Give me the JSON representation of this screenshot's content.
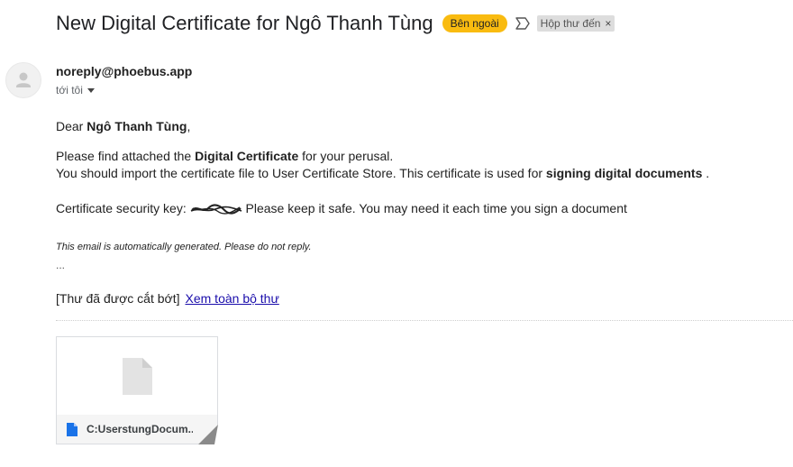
{
  "header": {
    "subject": "New Digital Certificate for Ngô Thanh Tùng",
    "external_badge": "Bên ngoài",
    "label": "Hộp thư đến",
    "label_remove": "×"
  },
  "sender": {
    "email": "noreply@phoebus.app",
    "recipient": "tới tôi"
  },
  "body": {
    "greeting_prefix": "Dear ",
    "greeting_name": "Ngô Thanh Tùng",
    "greeting_suffix": ",",
    "line1_prefix": "Please find attached the ",
    "line1_bold": "Digital Certificate",
    "line1_suffix": " for your perusal.",
    "line2_prefix": "You should import the certificate file to User Certificate Store. This certificate is used for ",
    "line2_bold": "signing digital documents",
    "line2_suffix": " .",
    "key_prefix": "Certificate security key: ",
    "key_suffix": " Please keep it safe. You may need it each time you sign a document",
    "auto_note": "This email is automatically generated. Please do not reply.",
    "ellipsis": "...",
    "clipped_text": "[Thư đã được cắt bớt]",
    "view_full_link": "Xem toàn bộ thư"
  },
  "attachment": {
    "file_name": "C:UserstungDocum..."
  },
  "colors": {
    "external_badge": "#f9bb10",
    "label_chip": "#dddddd",
    "link": "#1a0dab",
    "file_icon": "#1a73e8"
  }
}
